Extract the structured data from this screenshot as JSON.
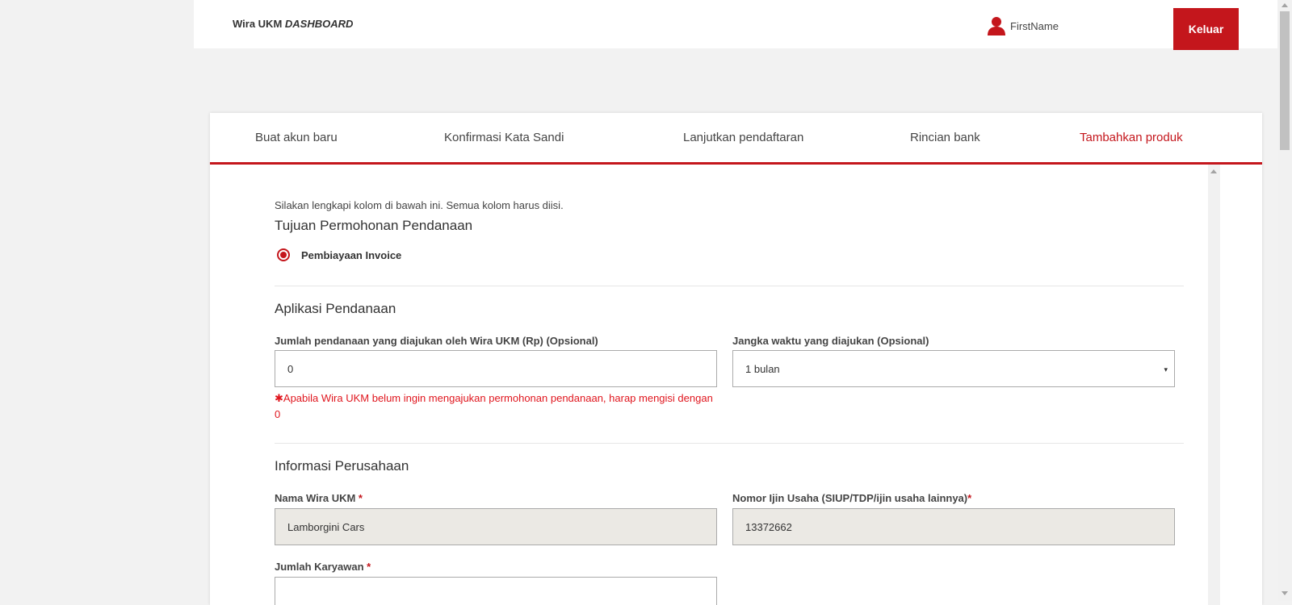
{
  "header": {
    "brand_prefix": "Wira UKM",
    "brand_suffix": "DASHBOARD",
    "user_name": "FirstName",
    "logout_label": "Keluar"
  },
  "tabs": [
    {
      "label": "Buat akun baru",
      "active": false
    },
    {
      "label": "Konfirmasi Kata Sandi",
      "active": false
    },
    {
      "label": "Lanjutkan pendaftaran",
      "active": false
    },
    {
      "label": "Rincian bank",
      "active": false
    },
    {
      "label": "Tambahkan produk",
      "active": true
    }
  ],
  "form": {
    "intro": "Silakan lengkapi kolom di bawah ini. Semua kolom harus diisi.",
    "purpose": {
      "title": "Tujuan Permohonan Pendanaan",
      "option_label": "Pembiayaan Invoice",
      "selected": true
    },
    "funding": {
      "title": "Aplikasi Pendanaan",
      "amount_label": "Jumlah pendanaan yang diajukan oleh Wira UKM (Rp) (Opsional)",
      "amount_value": "0",
      "note_star": "✱",
      "note": "Apabila Wira UKM belum ingin mengajukan permohonan pendanaan, harap mengisi dengan 0",
      "term_label": "Jangka waktu yang diajukan (Opsional)",
      "term_value": "1 bulan",
      "caret": "▾"
    },
    "company": {
      "title": "Informasi Perusahaan",
      "name_label": "Nama Wira UKM",
      "name_value": "Lamborgini Cars",
      "license_label": "Nomor Ijin Usaha (SIUP/TDP/ijin usaha lainnya)",
      "license_value": "13372662",
      "employees_label": "Jumlah Karyawan",
      "employees_value": "",
      "required_mark": "*"
    }
  },
  "colors": {
    "accent": "#c4161c",
    "note_red": "#e0161e",
    "background": "#f2f2f2",
    "readonly_field": "#ebe9e4"
  }
}
